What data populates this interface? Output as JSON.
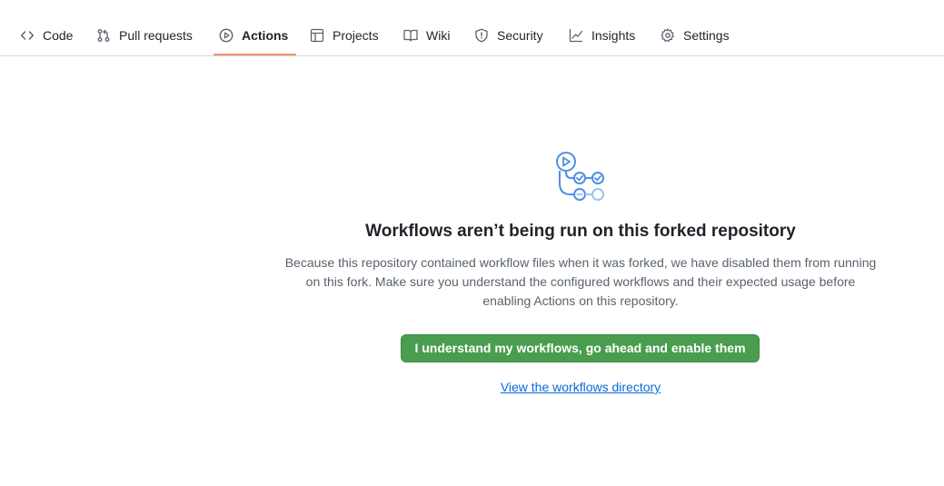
{
  "nav": {
    "tabs": [
      {
        "label": "Code",
        "icon": "code-icon"
      },
      {
        "label": "Pull requests",
        "icon": "pull-request-icon"
      },
      {
        "label": "Actions",
        "icon": "play-icon",
        "selected": true
      },
      {
        "label": "Projects",
        "icon": "table-icon"
      },
      {
        "label": "Wiki",
        "icon": "book-icon"
      },
      {
        "label": "Security",
        "icon": "shield-icon"
      },
      {
        "label": "Insights",
        "icon": "graph-icon"
      },
      {
        "label": "Settings",
        "icon": "gear-icon"
      }
    ],
    "selected_tab_color": "#fd8c73"
  },
  "main": {
    "illustration_icon": "workflow-icon",
    "title": "Workflows aren’t being run on this forked repository",
    "description_line1": "Because this repository contained workflow files when it was forked, we have disabled them from running",
    "description_line2": "on this fork. Make sure you understand the configured workflows and their expected usage before",
    "description_line3": "enabling Actions on this repository.",
    "enable_button_label": "I understand my workflows, go ahead and enable them",
    "view_link_label": "View the workflows directory",
    "button_color": "#4a9d4e",
    "link_color": "#0969da"
  }
}
